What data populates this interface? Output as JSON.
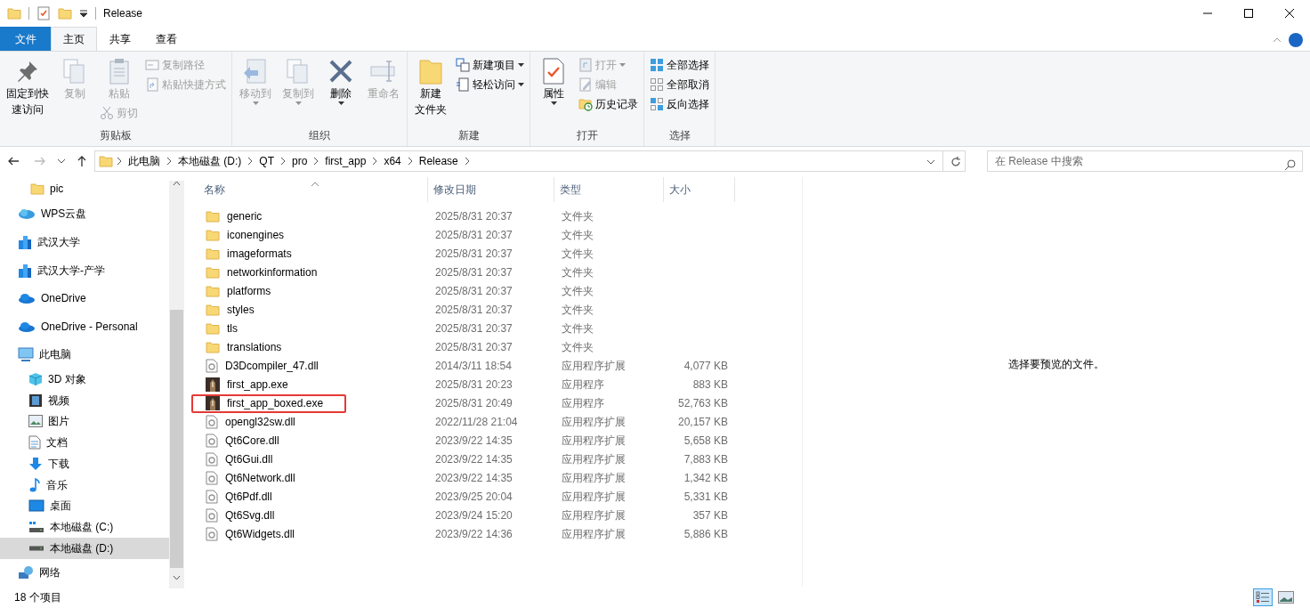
{
  "window": {
    "title": "Release"
  },
  "ribbon_tabs": [
    {
      "label": "文件",
      "kind": "file",
      "selected": false
    },
    {
      "label": "主页",
      "kind": "tab",
      "selected": true
    },
    {
      "label": "共享",
      "kind": "tab",
      "selected": false
    },
    {
      "label": "查看",
      "kind": "tab",
      "selected": false
    }
  ],
  "ribbon": {
    "groups": [
      {
        "label": "剪贴板",
        "columns": [
          [
            {
              "kind": "large",
              "lines": [
                "固定到快",
                "速访问"
              ],
              "disabled": false,
              "dropdown": false
            }
          ],
          [
            {
              "kind": "large",
              "label": "复制",
              "disabled": true,
              "dropdown": false
            }
          ],
          [
            {
              "kind": "large",
              "label": "粘贴",
              "disabled": true,
              "dropdown": false
            },
            {
              "kind": "small",
              "label": "剪切",
              "disabled": true,
              "dropdown": false
            }
          ],
          [
            {
              "kind": "small",
              "label": "复制路径",
              "disabled": true,
              "dropdown": false
            },
            {
              "kind": "small",
              "label": "粘贴快捷方式",
              "disabled": true,
              "dropdown": false
            }
          ]
        ]
      },
      {
        "label": "组织",
        "columns": [
          [
            {
              "kind": "large",
              "label": "移动到",
              "disabled": true,
              "dropdown": true
            }
          ],
          [
            {
              "kind": "large",
              "label": "复制到",
              "disabled": true,
              "dropdown": true
            }
          ],
          [
            {
              "kind": "large",
              "label": "删除",
              "disabled": false,
              "dropdown": true
            }
          ],
          [
            {
              "kind": "large",
              "label": "重命名",
              "disabled": true,
              "dropdown": false
            }
          ]
        ]
      },
      {
        "label": "新建",
        "columns": [
          [
            {
              "kind": "large",
              "lines": [
                "新建",
                "文件夹"
              ],
              "disabled": false,
              "dropdown": false
            }
          ],
          [
            {
              "kind": "small",
              "label": "新建项目",
              "disabled": false,
              "dropdown": true
            },
            {
              "kind": "small",
              "label": "轻松访问",
              "disabled": false,
              "dropdown": true
            }
          ]
        ]
      },
      {
        "label": "打开",
        "columns": [
          [
            {
              "kind": "large",
              "label": "属性",
              "disabled": false,
              "dropdown": true
            }
          ],
          [
            {
              "kind": "small",
              "label": "打开",
              "disabled": true,
              "dropdown": true
            },
            {
              "kind": "small",
              "label": "编辑",
              "disabled": true,
              "dropdown": false
            },
            {
              "kind": "small",
              "label": "历史记录",
              "disabled": false,
              "dropdown": false
            }
          ]
        ]
      },
      {
        "label": "选择",
        "columns": [
          [
            {
              "kind": "small",
              "label": "全部选择",
              "disabled": false,
              "dropdown": false
            },
            {
              "kind": "small",
              "label": "全部取消",
              "disabled": false,
              "dropdown": false
            },
            {
              "kind": "small",
              "label": "反向选择",
              "disabled": false,
              "dropdown": false
            }
          ]
        ]
      }
    ]
  },
  "address_bar": {
    "path": [
      "此电脑",
      "本地磁盘 (D:)",
      "QT",
      "pro",
      "first_app",
      "x64",
      "Release"
    ]
  },
  "search": {
    "placeholder": "在 Release 中搜索"
  },
  "nav_pane": {
    "continued_children": [
      {
        "label": "pic",
        "selected": false
      }
    ],
    "items": [
      {
        "label": "WPS云盘",
        "selected": false
      },
      {
        "label": "武汉大学",
        "selected": false
      },
      {
        "label": "武汉大学-产学",
        "selected": false
      },
      {
        "label": "OneDrive",
        "selected": false
      },
      {
        "label": "OneDrive - Personal",
        "selected": false
      },
      {
        "label": "此电脑",
        "selected": false,
        "children": [
          {
            "label": "3D 对象",
            "selected": false
          },
          {
            "label": "视频",
            "selected": false
          },
          {
            "label": "图片",
            "selected": false
          },
          {
            "label": "文档",
            "selected": false
          },
          {
            "label": "下载",
            "selected": false
          },
          {
            "label": "音乐",
            "selected": false
          },
          {
            "label": "桌面",
            "selected": false
          },
          {
            "label": "本地磁盘 (C:)",
            "selected": false
          },
          {
            "label": "本地磁盘 (D:)",
            "selected": true
          }
        ]
      },
      {
        "label": "网络",
        "selected": false
      }
    ]
  },
  "file_list": {
    "columns": [
      "名称",
      "修改日期",
      "类型",
      "大小"
    ],
    "rows": [
      {
        "kind": "folder",
        "name": "generic",
        "modified": "2025/8/31 20:37",
        "type": "文件夹",
        "selected": false,
        "highlighted": false
      },
      {
        "kind": "folder",
        "name": "iconengines",
        "modified": "2025/8/31 20:37",
        "type": "文件夹",
        "selected": false,
        "highlighted": false
      },
      {
        "kind": "folder",
        "name": "imageformats",
        "modified": "2025/8/31 20:37",
        "type": "文件夹",
        "selected": false,
        "highlighted": false
      },
      {
        "kind": "folder",
        "name": "networkinformation",
        "modified": "2025/8/31 20:37",
        "type": "文件夹",
        "selected": false,
        "highlighted": false
      },
      {
        "kind": "folder",
        "name": "platforms",
        "modified": "2025/8/31 20:37",
        "type": "文件夹",
        "selected": false,
        "highlighted": false
      },
      {
        "kind": "folder",
        "name": "styles",
        "modified": "2025/8/31 20:37",
        "type": "文件夹",
        "selected": false,
        "highlighted": false
      },
      {
        "kind": "folder",
        "name": "tls",
        "modified": "2025/8/31 20:37",
        "type": "文件夹",
        "selected": false,
        "highlighted": false
      },
      {
        "kind": "folder",
        "name": "translations",
        "modified": "2025/8/31 20:37",
        "type": "文件夹",
        "selected": false,
        "highlighted": false
      },
      {
        "kind": "dll",
        "name": "D3Dcompiler_47.dll",
        "modified": "2014/3/11 18:54",
        "type": "应用程序扩展",
        "size": "4,077 KB",
        "selected": false,
        "highlighted": false
      },
      {
        "kind": "exe",
        "name": "first_app.exe",
        "modified": "2025/8/31 20:23",
        "type": "应用程序",
        "size": "883 KB",
        "selected": false,
        "highlighted": false
      },
      {
        "kind": "exe",
        "name": "first_app_boxed.exe",
        "modified": "2025/8/31 20:49",
        "type": "应用程序",
        "size": "52,763 KB",
        "selected": false,
        "highlighted": true
      },
      {
        "kind": "dll",
        "name": "opengl32sw.dll",
        "modified": "2022/11/28 21:04",
        "type": "应用程序扩展",
        "size": "20,157 KB",
        "selected": false,
        "highlighted": false
      },
      {
        "kind": "dll",
        "name": "Qt6Core.dll",
        "modified": "2023/9/22 14:35",
        "type": "应用程序扩展",
        "size": "5,658 KB",
        "selected": false,
        "highlighted": false
      },
      {
        "kind": "dll",
        "name": "Qt6Gui.dll",
        "modified": "2023/9/22 14:35",
        "type": "应用程序扩展",
        "size": "7,883 KB",
        "selected": false,
        "highlighted": false
      },
      {
        "kind": "dll",
        "name": "Qt6Network.dll",
        "modified": "2023/9/22 14:35",
        "type": "应用程序扩展",
        "size": "1,342 KB",
        "selected": false,
        "highlighted": false
      },
      {
        "kind": "dll",
        "name": "Qt6Pdf.dll",
        "modified": "2023/9/25 20:04",
        "type": "应用程序扩展",
        "size": "5,331 KB",
        "selected": false,
        "highlighted": false
      },
      {
        "kind": "dll",
        "name": "Qt6Svg.dll",
        "modified": "2023/9/24 15:20",
        "type": "应用程序扩展",
        "size": "357 KB",
        "selected": false,
        "highlighted": false
      },
      {
        "kind": "dll",
        "name": "Qt6Widgets.dll",
        "modified": "2023/9/22 14:36",
        "type": "应用程序扩展",
        "size": "5,886 KB",
        "selected": false,
        "highlighted": false
      }
    ]
  },
  "preview_pane": {
    "message": "选择要预览的文件。"
  },
  "status_bar": {
    "item_count": "18 个项目",
    "views": [
      {
        "kind": "details",
        "selected": true
      },
      {
        "kind": "large_icons",
        "selected": false
      }
    ]
  }
}
